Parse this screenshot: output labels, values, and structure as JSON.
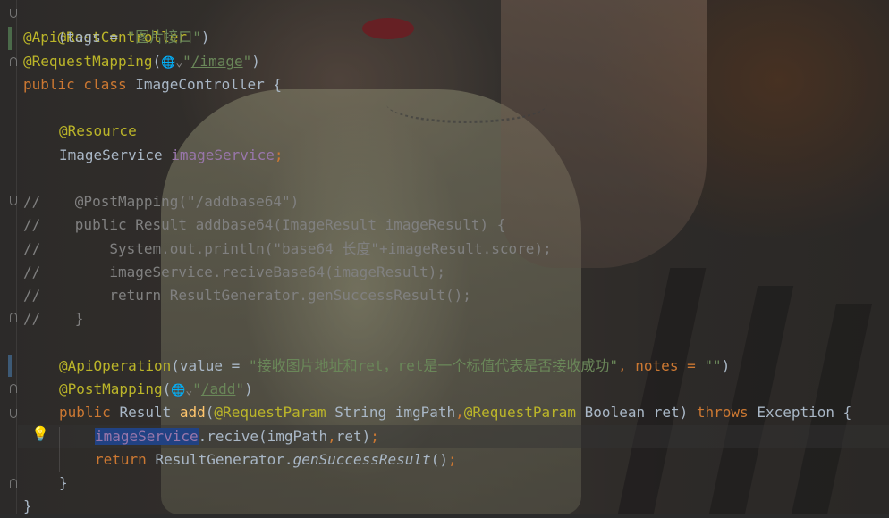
{
  "code": {
    "l1": "@RestController",
    "l2_ann": "@Api",
    "l2_rest": "(tags = ",
    "l2_str": "\"图片接口\"",
    "l2_close": ")",
    "l3_ann": "@RequestMapping",
    "l3_open": "(",
    "l3_q1": "\"",
    "l3_path": "/image",
    "l3_q2": "\"",
    "l3_close": ")",
    "l4_kw": "public class ",
    "l4_name": "ImageController {",
    "l6": "@Resource",
    "l7_type": "ImageService ",
    "l7_field": "imageService",
    "l7_semi": ";",
    "l9": "//    @PostMapping(\"/addbase64\")",
    "l10": "//    public Result addbase64(ImageResult imageResult) {",
    "l11": "//        System.out.println(\"base64 长度\"+imageResult.score);",
    "l12": "//        imageService.reciveBase64(imageResult);",
    "l13": "//        return ResultGenerator.genSuccessResult();",
    "l14": "//    }",
    "l16_ann": "@ApiOperation",
    "l16_a": "(value = ",
    "l16_str": "\"接收图片地址和ret，ret是一个标值代表是否接收成功\"",
    "l16_b": ", notes = ",
    "l16_str2": "\"\"",
    "l16_c": ")",
    "l17_ann": "@PostMapping",
    "l17_open": "(",
    "l17_q1": "\"",
    "l17_path": "/add",
    "l17_q2": "\"",
    "l17_close": ")",
    "l18_kw": "public ",
    "l18_a": "Result ",
    "l18_m": "add",
    "l18_b": "(",
    "l18_ann1": "@RequestParam",
    "l18_c": " String imgPath",
    "l18_comma": ",",
    "l18_ann2": "@RequestParam",
    "l18_d": " Boolean ret) ",
    "l18_throws": "throws",
    "l18_e": " Exception {",
    "l19_sel": "imageService",
    "l19_rest": ".recive(imgPath",
    "l19_comma": ",",
    "l19_rest2": "ret)",
    "l19_semi": ";",
    "l20_kw": "return ",
    "l20_cls": "ResultGenerator.",
    "l20_m": "genSuccessResult",
    "l20_end": "()",
    "l20_semi": ";",
    "l21": "}",
    "l22": "}"
  },
  "icons": {
    "globe": "🌐",
    "chevron": "⌄",
    "bulb": "💡"
  }
}
